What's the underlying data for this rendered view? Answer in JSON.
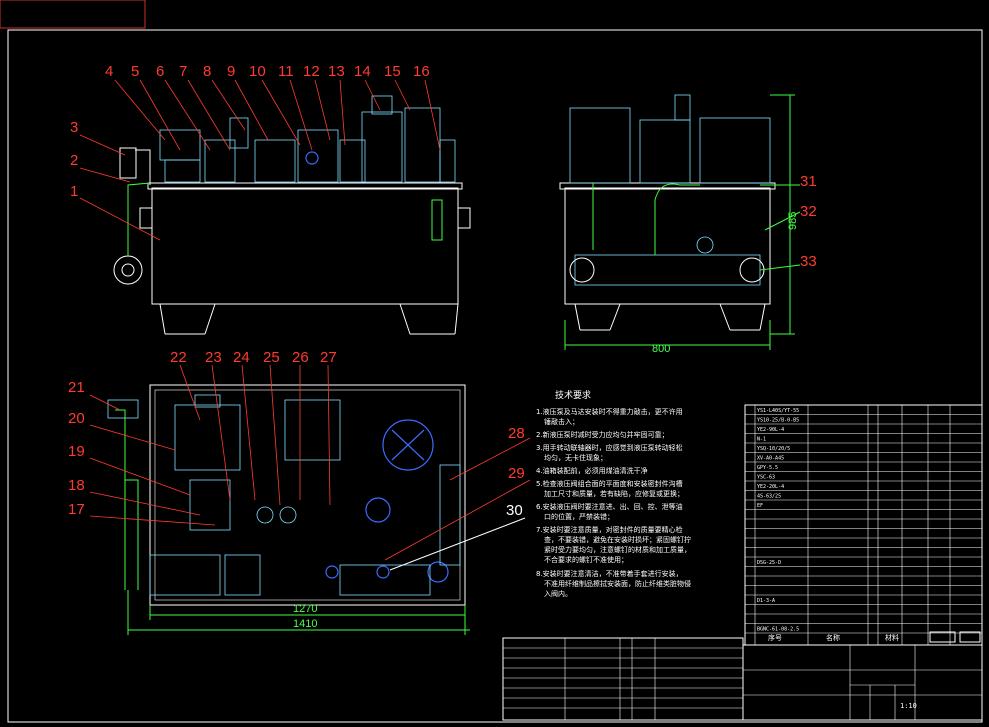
{
  "drawing": {
    "front_view_labels": [
      "4",
      "5",
      "6",
      "7",
      "8",
      "9",
      "10",
      "11",
      "12",
      "13",
      "14",
      "15",
      "16"
    ],
    "front_view_left_labels": [
      "3",
      "2",
      "1"
    ],
    "side_view_labels": [
      "31",
      "32",
      "33"
    ],
    "side_dims": {
      "width": "800",
      "height": "985"
    },
    "plan_view_labels_top": [
      "22",
      "23",
      "24",
      "25",
      "26",
      "27"
    ],
    "plan_view_labels_left": [
      "21",
      "20",
      "19",
      "18",
      "17"
    ],
    "plan_view_labels_right": [
      "28",
      "29",
      "30"
    ],
    "plan_dims": {
      "inner": "1270",
      "outer": "1410"
    },
    "tech_title": "技术要求",
    "tech_lines": [
      "1.液压泵及马达安装时不得重力敲击，更不许用",
      "锤敲击入；",
      "2.新液压泵时减时受力应均匀并牢固可靠；",
      "3.用手转动联轴器时，应感觉到液压泵转动轻松",
      "均匀，无卡住现象；",
      "4.油箱装配前，必须用煤油清洗干净",
      "5.检查液压阀组合面的平面度和安装密封件沟槽",
      "加工尺寸和质量，若有缺陷，应修复或更换；",
      "6.安装液压阀时要注意进、出、回、控、泄等油",
      "口的位置，严禁装错；",
      "7.安装时要注意质量，对密封件的质量要精心检",
      "查，不要装错，避免在安装时损坏；紧固螺钉拧",
      "紧时受力要均匀，注意螺钉的材质和加工质量，",
      "不合要求的螺钉不准使用；",
      "8.安装时要注意清洁，不准带着手套进行安装，",
      "不准用纤维制品擦拭安装面，防止纤维类脏物侵",
      "入阀内。"
    ],
    "right_table_rows": [
      "YS1-L40S/YT-55",
      "YS10-25/B-0-B5",
      "YE2-90L-4",
      "N-1",
      "YSQ-10/20/5",
      "XV-A0-A45",
      "GPY-5.5",
      "YSC-63",
      "YE2-20L-4",
      "4S-63/25",
      "EF",
      "",
      "",
      "",
      "",
      "",
      "D5G-25-D",
      "",
      "",
      "",
      "D1-3-A",
      "",
      "",
      "BGNC-61-08-2.5"
    ],
    "right_table_footer": [
      "序号",
      "名称",
      "材料"
    ],
    "title_block": {
      "school": "",
      "scale": "1:10"
    }
  }
}
